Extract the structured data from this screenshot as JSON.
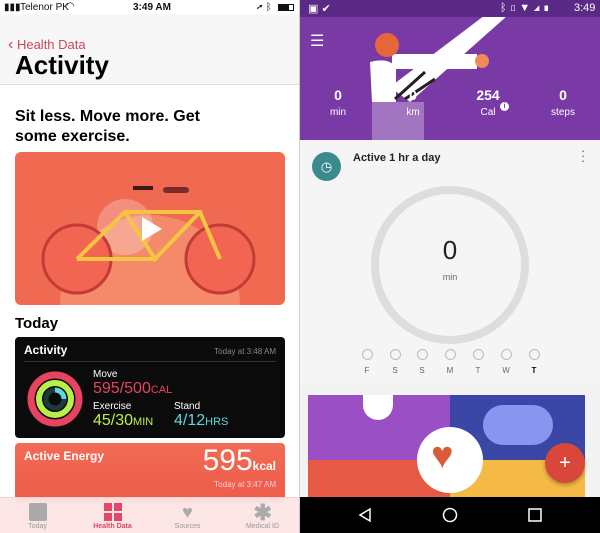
{
  "left": {
    "status": {
      "carrier": "Telenor PK",
      "time": "3:49 AM"
    },
    "nav": {
      "back_label": "Health Data",
      "title": "Activity"
    },
    "headline": "Sit less. Move more. Get some exercise.",
    "section": "Today",
    "activity_card": {
      "title": "Activity",
      "timestamp": "Today at 3:48 AM",
      "move_label": "Move",
      "move_value": "595/500",
      "move_unit": "CAL",
      "exercise_label": "Exercise",
      "exercise_value": "45/30",
      "exercise_unit": "MIN",
      "stand_label": "Stand",
      "stand_value": "4/12",
      "stand_unit": "HRS",
      "colors": {
        "move": "#e8435f",
        "exercise": "#b8f04a",
        "stand": "#5fd8e0"
      }
    },
    "energy_card": {
      "title": "Active Energy",
      "value": "595",
      "unit": "kcal",
      "timestamp": "Today at 3:47 AM"
    },
    "tabs": [
      {
        "label": "Today",
        "icon": "calendar-icon"
      },
      {
        "label": "Health Data",
        "icon": "grid-icon",
        "active": true
      },
      {
        "label": "Sources",
        "icon": "heart-download-icon"
      },
      {
        "label": "Medical ID",
        "icon": "asterisk-icon"
      }
    ],
    "accent": "#c9485f"
  },
  "right": {
    "status": {
      "time": "3:49"
    },
    "stats": [
      {
        "value": "0",
        "label": "min"
      },
      {
        "value": "0",
        "label": "km"
      },
      {
        "value": "254",
        "label": "Cal"
      },
      {
        "value": "0",
        "label": "steps"
      }
    ],
    "goal": {
      "title": "Active 1 hr a day",
      "value": "0",
      "unit": "min",
      "progress": 0
    },
    "days": [
      "F",
      "S",
      "S",
      "M",
      "T",
      "W",
      "T"
    ],
    "colors": {
      "header": "#7a3aa6",
      "fab": "#d9473a",
      "goal_icon": "#3a8b8f"
    }
  }
}
